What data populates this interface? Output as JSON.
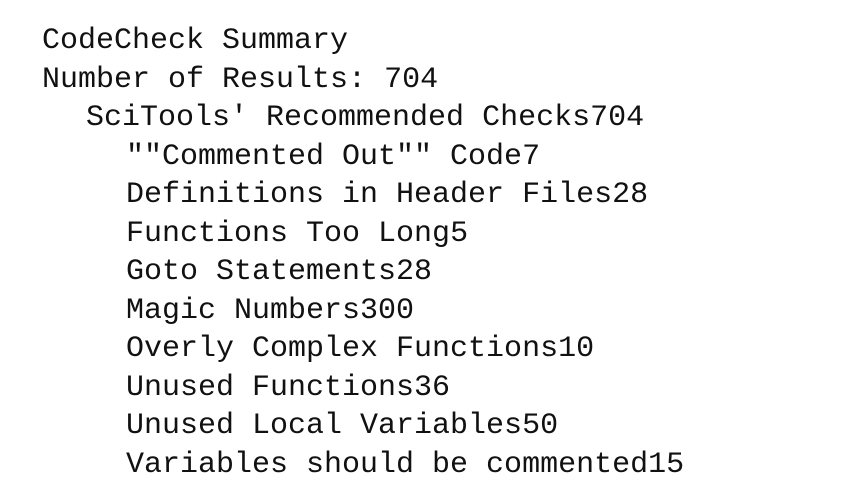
{
  "summary": {
    "title": "CodeCheck Summary",
    "results_label": "Number of Results: ",
    "results_count": "704"
  },
  "group": {
    "name": "SciTools' Recommended Checks",
    "count": "704"
  },
  "checks": [
    {
      "name": "\"\"Commented Out\"\" Code",
      "count": "7"
    },
    {
      "name": "Definitions in Header Files",
      "count": "28"
    },
    {
      "name": "Functions Too Long",
      "count": "5"
    },
    {
      "name": "Goto Statements",
      "count": "28"
    },
    {
      "name": "Magic Numbers",
      "count": "300"
    },
    {
      "name": "Overly Complex Functions",
      "count": "10"
    },
    {
      "name": "Unused Functions",
      "count": "36"
    },
    {
      "name": "Unused Local Variables",
      "count": "50"
    },
    {
      "name": "Variables should be commented",
      "count": "15"
    }
  ]
}
